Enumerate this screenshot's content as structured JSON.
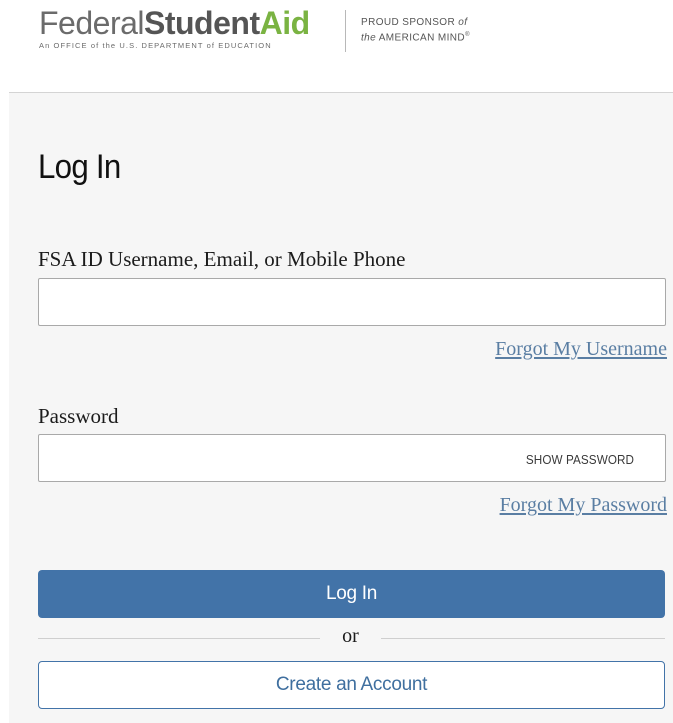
{
  "header": {
    "logo": {
      "word_federal": "Federal",
      "word_student": "Student",
      "word_aid": "Aid",
      "tagline": "An OFFICE of the U.S. DEPARTMENT of EDUCATION"
    },
    "sponsor": {
      "line1_main": "PROUD SPONSOR ",
      "line1_italic": "of",
      "line2_italic": "the",
      "line2_main": " AMERICAN MIND",
      "mark": "®"
    }
  },
  "login_form": {
    "title": "Log In",
    "username": {
      "label": "FSA ID Username, Email, or Mobile Phone",
      "value": "",
      "placeholder": "",
      "forgot_link": "Forgot My Username"
    },
    "password": {
      "label": "Password",
      "value": "",
      "placeholder": "",
      "show_toggle": "SHOW PASSWORD",
      "forgot_link": "Forgot My Password"
    },
    "submit_label": "Log In",
    "divider_text": "or",
    "create_account_label": "Create an Account"
  },
  "colors": {
    "primary": "#4273a8",
    "link": "#5a7ea3",
    "logo_green": "#7ab342",
    "panel_background": "#f6f6f6"
  }
}
